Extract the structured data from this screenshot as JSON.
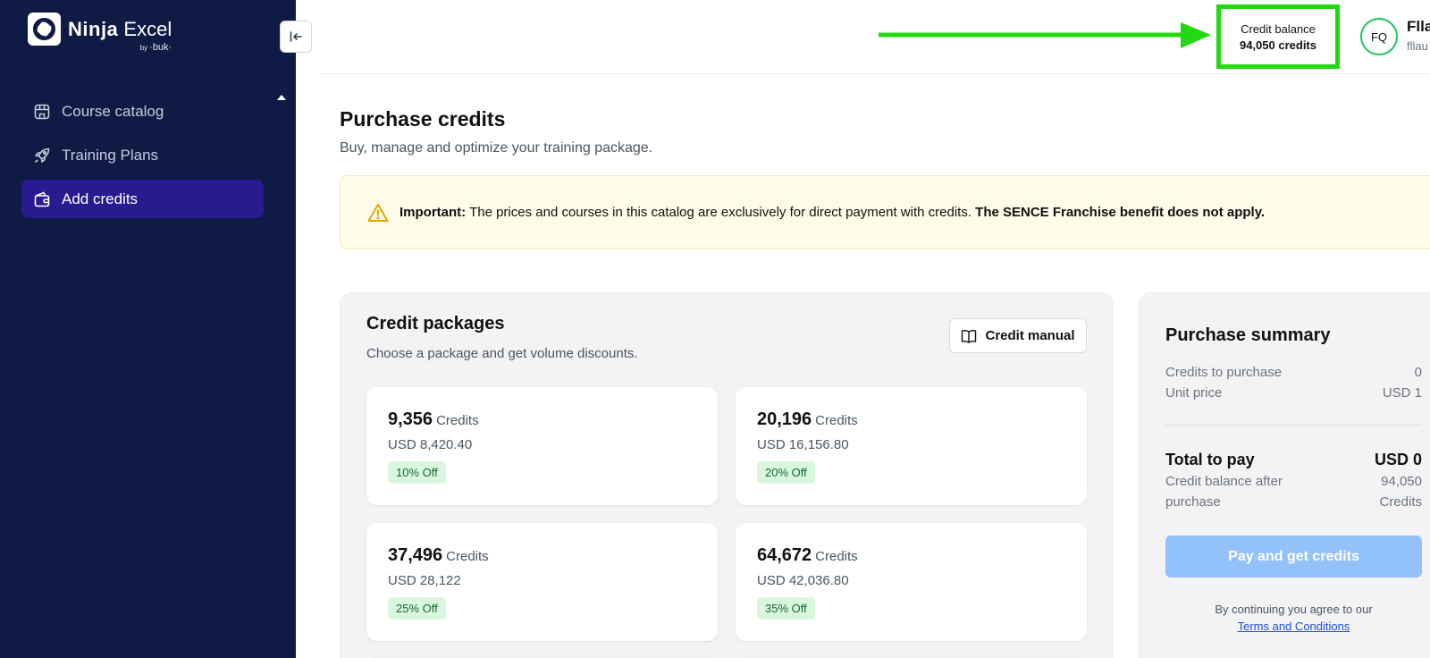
{
  "app": {
    "name_bold": "Ninja",
    "name_rest": "Excel",
    "by_label": "by",
    "brand": "·buk·"
  },
  "sidebar": {
    "items": [
      {
        "label": "Course catalog",
        "icon": "store-icon",
        "active": false
      },
      {
        "label": "Training Plans",
        "icon": "rocket-icon",
        "active": false
      },
      {
        "label": "Add credits",
        "icon": "wallet-icon",
        "active": true
      }
    ]
  },
  "header": {
    "credit_balance_label": "Credit balance",
    "credit_balance_value": "94,050 credits",
    "avatar_initials": "FQ",
    "user_name": "Fllau",
    "user_email": "fllau"
  },
  "page": {
    "title": "Purchase credits",
    "subtitle": "Buy, manage and optimize your training package."
  },
  "notice": {
    "strong_lead": "Important:",
    "text": " The prices and courses in this catalog are exclusively for direct payment with credits. ",
    "strong_tail": "The SENCE Franchise benefit does not apply."
  },
  "packages": {
    "title": "Credit packages",
    "subtitle": "Choose a package and get volume discounts.",
    "manual_label": "Credit manual",
    "unit_label": "Credits",
    "items": [
      {
        "credits": "9,356",
        "price": "USD 8,420.40",
        "discount": "10% Off"
      },
      {
        "credits": "20,196",
        "price": "USD 16,156.80",
        "discount": "20% Off"
      },
      {
        "credits": "37,496",
        "price": "USD 28,122",
        "discount": "25% Off"
      },
      {
        "credits": "64,672",
        "price": "USD 42,036.80",
        "discount": "35% Off"
      }
    ]
  },
  "summary": {
    "title": "Purchase summary",
    "credits_to_purchase_label": "Credits to purchase",
    "credits_to_purchase_value": "0",
    "unit_price_label": "Unit price",
    "unit_price_value": "USD 1",
    "total_label": "Total to pay",
    "total_value": "USD 0",
    "balance_after_label_1": "Credit balance after",
    "balance_after_label_2": "purchase",
    "balance_after_value_1": "94,050",
    "balance_after_value_2": "Credits",
    "pay_button": "Pay and get credits",
    "agree_text": "By continuing you agree to our",
    "terms_link": "Terms and Conditions"
  },
  "colors": {
    "sidebar_bg": "#0f1a45",
    "nav_active": "#2a1a8f",
    "highlight": "#22d811",
    "badge_bg": "#d9f7df",
    "pay_button": "#93c1fa"
  }
}
